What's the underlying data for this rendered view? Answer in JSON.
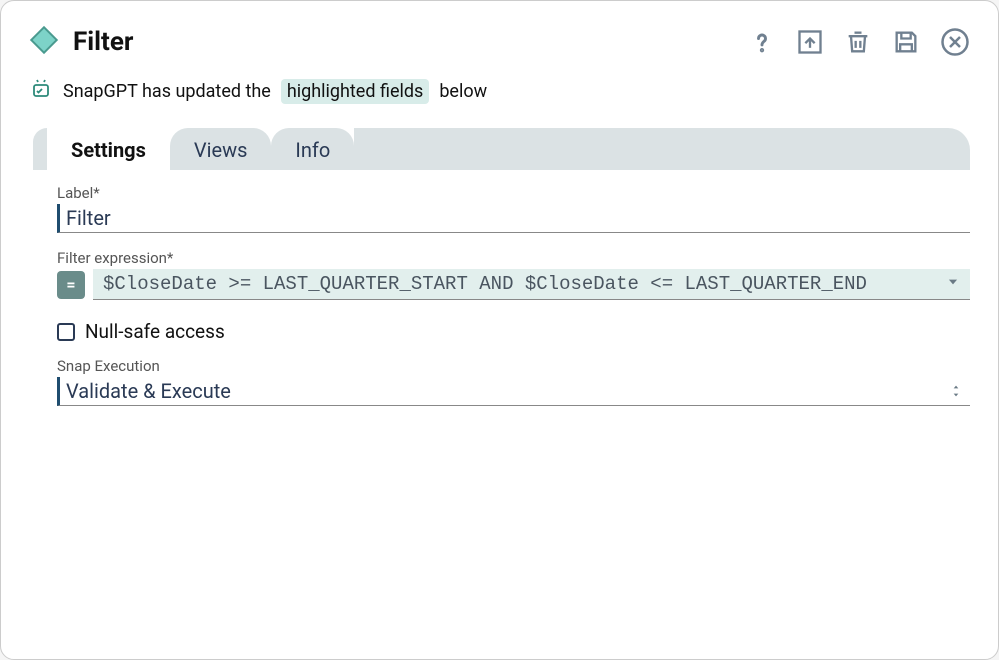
{
  "header": {
    "title": "Filter"
  },
  "notice": {
    "prefix": "SnapGPT has updated the",
    "highlight": "highlighted fields",
    "suffix": "below"
  },
  "tabs": {
    "settings": "Settings",
    "views": "Views",
    "info": "Info"
  },
  "fields": {
    "label_label": "Label*",
    "label_value": "Filter",
    "expr_label": "Filter expression*",
    "expr_value": "$CloseDate >= LAST_QUARTER_START AND $CloseDate <= LAST_QUARTER_END",
    "nullsafe_label": "Null-safe access",
    "exec_label": "Snap Execution",
    "exec_value": "Validate & Execute"
  }
}
